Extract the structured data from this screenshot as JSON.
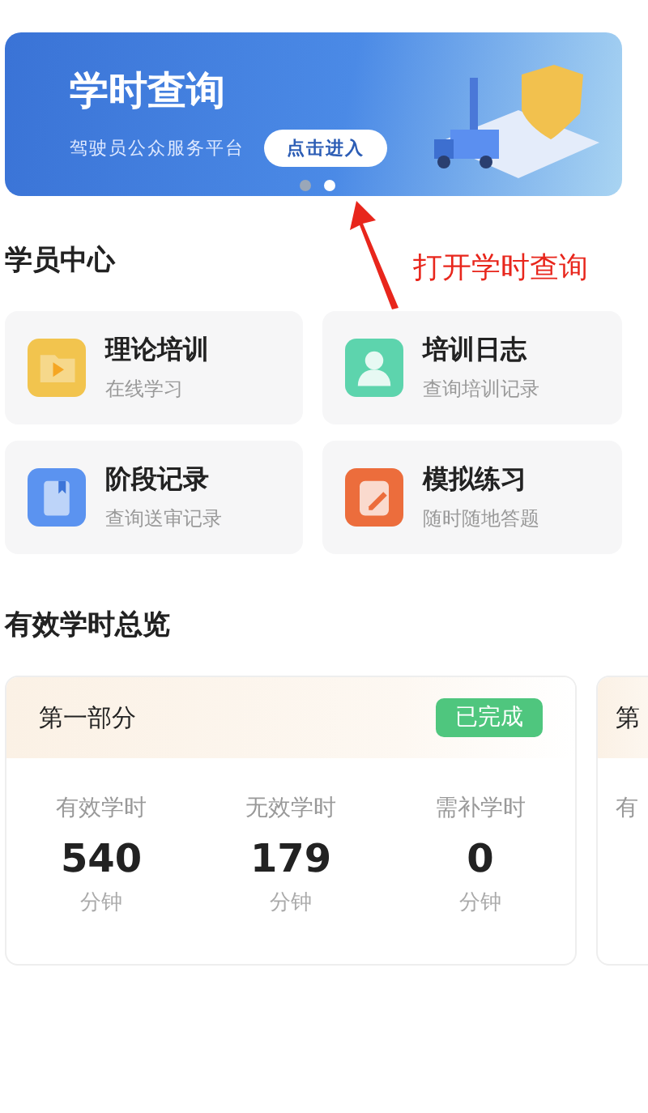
{
  "banner": {
    "title": "学时查询",
    "subtitle": "驾驶员公众服务平台",
    "button": "点击进入",
    "dots": [
      {
        "selected": false
      },
      {
        "selected": true
      }
    ]
  },
  "annotation": {
    "text": "打开学时查询"
  },
  "student_center": {
    "title": "学员中心",
    "items": [
      {
        "title": "理论培训",
        "subtitle": "在线学习",
        "kind": "video",
        "color": "#f2c44e"
      },
      {
        "title": "培训日志",
        "subtitle": "查询培训记录",
        "kind": "person",
        "color": "#5dd4ad"
      },
      {
        "title": "阶段记录",
        "subtitle": "查询送审记录",
        "kind": "book",
        "color": "#5b93f0"
      },
      {
        "title": "模拟练习",
        "subtitle": "随时随地答题",
        "kind": "pencil",
        "color": "#ec6d3c"
      }
    ]
  },
  "overview": {
    "title": "有效学时总览",
    "parts": [
      {
        "title": "第一部分",
        "status": "已完成",
        "stats": [
          {
            "label": "有效学时",
            "value": "540",
            "unit": "分钟"
          },
          {
            "label": "无效学时",
            "value": "179",
            "unit": "分钟"
          },
          {
            "label": "需补学时",
            "value": "0",
            "unit": "分钟"
          }
        ]
      },
      {
        "title": "第",
        "stats": [
          {
            "label": "有"
          }
        ]
      }
    ]
  }
}
